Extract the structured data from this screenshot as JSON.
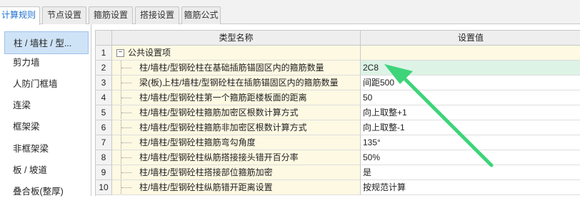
{
  "tabs": [
    {
      "label": "计算规则",
      "active": true
    },
    {
      "label": "节点设置",
      "active": false
    },
    {
      "label": "箍筋设置",
      "active": false
    },
    {
      "label": "搭接设置",
      "active": false
    },
    {
      "label": "箍筋公式",
      "active": false
    }
  ],
  "sidebar": {
    "items": [
      {
        "label": "柱 / 墙柱 / 型...",
        "selected": true
      },
      {
        "label": "剪力墙",
        "selected": false
      },
      {
        "label": "人防门框墙",
        "selected": false
      },
      {
        "label": "连梁",
        "selected": false
      },
      {
        "label": "框架梁",
        "selected": false
      },
      {
        "label": "非框架梁",
        "selected": false
      },
      {
        "label": "板 / 坡道",
        "selected": false
      },
      {
        "label": "叠合板(整厚)",
        "selected": false
      }
    ]
  },
  "grid": {
    "headers": {
      "name": "类型名称",
      "value": "设置值"
    },
    "group": {
      "row": "1",
      "collapse_symbol": "−",
      "label": "公共设置项"
    },
    "rows": [
      {
        "n": "2",
        "name": "柱/墙柱/型钢砼柱在基础插筋锚固区内的箍筋数量",
        "value": "2C8",
        "highlighted": true
      },
      {
        "n": "3",
        "name": "梁(板)上柱/墙柱/型钢砼柱在插筋锚固区内的箍筋数量",
        "value": "间距500",
        "highlighted": false
      },
      {
        "n": "4",
        "name": "柱/墙柱/型钢砼柱第一个箍筋距楼板面的距离",
        "value": "50",
        "highlighted": false
      },
      {
        "n": "5",
        "name": "柱/墙柱/型钢砼柱箍筋加密区根数计算方式",
        "value": "向上取整+1",
        "highlighted": false
      },
      {
        "n": "6",
        "name": "柱/墙柱/型钢砼柱箍筋非加密区根数计算方式",
        "value": "向上取整-1",
        "highlighted": false
      },
      {
        "n": "7",
        "name": "柱/墙柱/型钢砼柱箍筋弯勾角度",
        "value": "135°",
        "highlighted": false
      },
      {
        "n": "8",
        "name": "柱/墙柱/型钢砼柱纵筋搭接接头错开百分率",
        "value": "50%",
        "highlighted": false
      },
      {
        "n": "9",
        "name": "柱/墙柱/型钢砼柱搭接部位箍筋加密",
        "value": "是",
        "highlighted": false
      },
      {
        "n": "10",
        "name": "柱/墙柱/型钢砼柱纵筋错开距离设置",
        "value": "按规范计算",
        "highlighted": false
      }
    ]
  },
  "colors": {
    "accent": "#1e6fcf",
    "selection_bg": "#cfe3f7",
    "name_cell_bg": "#fdf9e3",
    "highlight_value_bg": "#ddf3e6",
    "annotation_arrow": "#3dd47a"
  },
  "icons": {
    "annotation": "arrow-pointer-icon",
    "tree_toggle": "collapse-minus-icon"
  }
}
